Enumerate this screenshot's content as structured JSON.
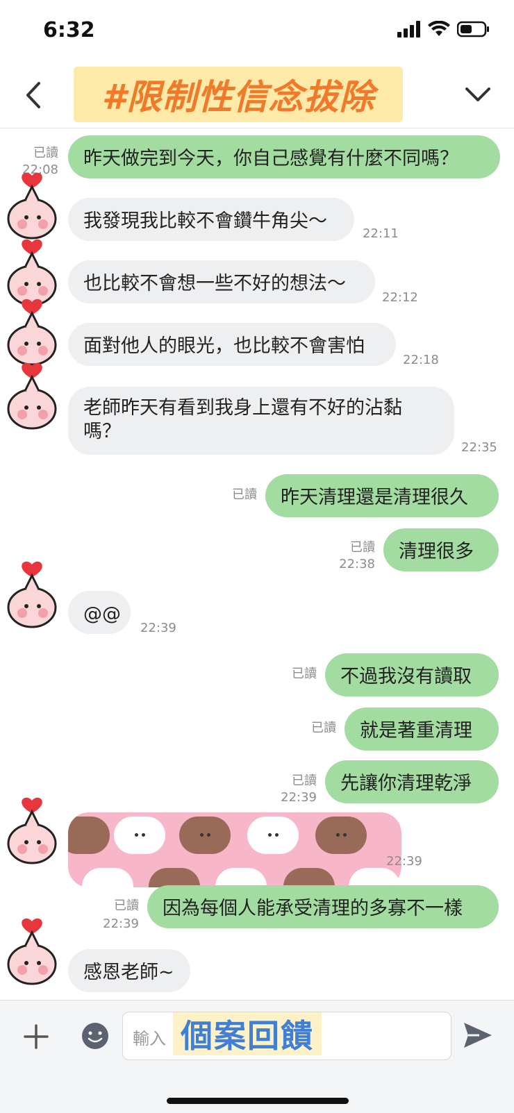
{
  "status_bar": {
    "time": "6:32"
  },
  "header": {
    "title": "#限制性信念拔除"
  },
  "messages": [
    {
      "side": "right",
      "text": "昨天做完到今天，你自己感覺有什麼不同嗎？",
      "read": "已讀",
      "time": "22:08"
    },
    {
      "side": "left",
      "text": "我發現我比較不會鑽牛角尖～",
      "time": "22:11"
    },
    {
      "side": "left",
      "text": "也比較不會想一些不好的想法～",
      "time": "22:12"
    },
    {
      "side": "left",
      "text": "面對他人的眼光，也比較不會害怕",
      "time": "22:18"
    },
    {
      "side": "left",
      "text_line1": "老師昨天有看到我身上還有不好的沾黏",
      "text_line2": "嗎？",
      "time": "22:35"
    },
    {
      "side": "right",
      "text": "昨天清理還是清理很久",
      "read": "已讀"
    },
    {
      "side": "right",
      "text": "清理很多",
      "read": "已讀",
      "time": "22:38"
    },
    {
      "side": "left",
      "text": "@@",
      "time": "22:39"
    },
    {
      "side": "right",
      "text": "不過我沒有讀取",
      "read": "已讀"
    },
    {
      "side": "right",
      "text": "就是著重清理",
      "read": "已讀"
    },
    {
      "side": "right",
      "text": "先讓你清理乾淨",
      "read": "已讀",
      "time": "22:39"
    },
    {
      "side": "left",
      "type": "sticker",
      "time": "22:39"
    },
    {
      "side": "right",
      "text": "因為每個人能承受清理的多寡不一樣",
      "read": "已讀",
      "time": "22:39"
    },
    {
      "side": "left",
      "text": "感恩老師~"
    }
  ],
  "input": {
    "placeholder": "輸入",
    "overlay_tag": "個案回饋"
  },
  "colors": {
    "right_bubble": "#a3dca1",
    "left_bubble": "#eeeff1",
    "title_text": "#f07a2a",
    "title_bg": "#fde9a8",
    "tag_text": "#3f7fd6"
  }
}
